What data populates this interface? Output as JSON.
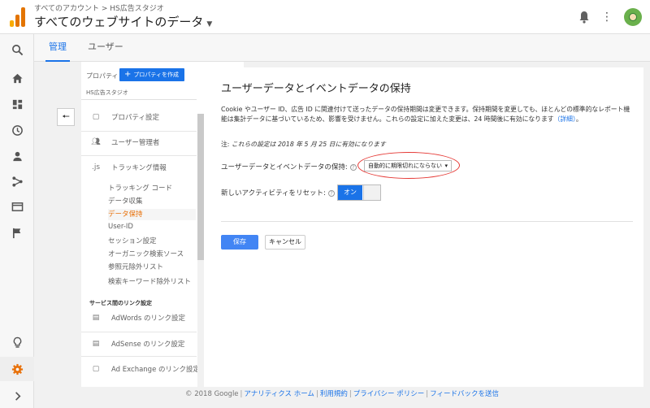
{
  "header": {
    "breadcrumb": "すべてのアカウント > HS広告スタジオ",
    "title": "すべてのウェブサイトのデータ",
    "icons": [
      "analytics-logo-icon",
      "bell-icon",
      "more-vert-icon",
      "avatar"
    ]
  },
  "rail": {
    "icons": [
      "search-icon",
      "home-icon",
      "dashboard-icon",
      "clock-icon",
      "person-icon",
      "share-icon",
      "display-icon",
      "flag-icon",
      "lightbulb-icon",
      "gear-icon",
      "chevron-right-icon"
    ]
  },
  "tabs": [
    {
      "label": "管理",
      "active": true
    },
    {
      "label": "ユーザー",
      "active": false
    }
  ],
  "property": {
    "label": "プロパティ",
    "create_label": "プロパティを作成",
    "name": "HS広告スタジオ",
    "menu": {
      "settings": "プロパティ設定",
      "users": "ユーザー管理者",
      "tracking": "トラッキング情報",
      "tracking_icon_text": ".js"
    },
    "tracking_sub": [
      {
        "label": "トラッキング コード",
        "active": false
      },
      {
        "label": "データ収集",
        "active": false
      },
      {
        "label": "データ保持",
        "active": true
      },
      {
        "label": "User-ID",
        "active": false
      },
      {
        "label": "セッション設定",
        "active": false
      },
      {
        "label": "オーガニック検索ソース",
        "active": false
      },
      {
        "label": "参照元除外リスト",
        "active": false
      },
      {
        "label": "検索キーワード除外リスト",
        "active": false
      }
    ],
    "links_header": "サービス間のリンク設定",
    "links": {
      "adwords": "AdWords のリンク設定",
      "adsense": "AdSense のリンク設定",
      "adexchange": "Ad Exchange のリンク設定"
    }
  },
  "panel": {
    "title": "ユーザーデータとイベントデータの保持",
    "description": "Cookie やユーザー ID、広告 ID に関連付けて送ったデータの保持期間は変更できます。保持期間を変更しても、ほとんどの標準的なレポート機能は集計データに基づいているため、影響を受けません。これらの設定に加えた変更は、24 時間後に有効になります",
    "details_link": "（詳細）",
    "note_prefix": "注: ",
    "note": "これらの設定は 2018 年 5 月 25 日に有効になります",
    "retention_label": "ユーザーデータとイベントデータの保持:",
    "retention_value": "自動的に期限切れにならない",
    "reset_label": "新しいアクティビティをリセット:",
    "reset_toggle": "オン",
    "save_label": "保存",
    "cancel_label": "キャンセル",
    "highlight_color": "#e53935"
  },
  "footer": {
    "copyright": "© 2018 Google",
    "links": [
      "アナリティクス ホーム",
      "利用規約",
      "プライバシー ポリシー",
      "フィードバックを送信"
    ]
  },
  "colors": {
    "accent": "#1a73e8",
    "active_menu": "#e8710a",
    "settings_gear": "#e8710a"
  }
}
